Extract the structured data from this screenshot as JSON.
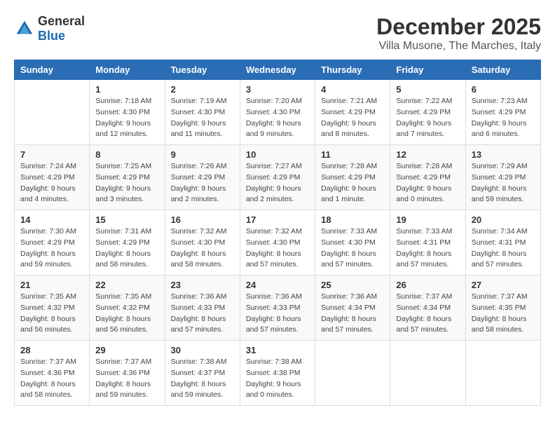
{
  "header": {
    "logo_general": "General",
    "logo_blue": "Blue",
    "month": "December 2025",
    "location": "Villa Musone, The Marches, Italy"
  },
  "days_of_week": [
    "Sunday",
    "Monday",
    "Tuesday",
    "Wednesday",
    "Thursday",
    "Friday",
    "Saturday"
  ],
  "weeks": [
    [
      {
        "day": "",
        "sunrise": "",
        "sunset": "",
        "daylight": ""
      },
      {
        "day": "1",
        "sunrise": "Sunrise: 7:18 AM",
        "sunset": "Sunset: 4:30 PM",
        "daylight": "Daylight: 9 hours and 12 minutes."
      },
      {
        "day": "2",
        "sunrise": "Sunrise: 7:19 AM",
        "sunset": "Sunset: 4:30 PM",
        "daylight": "Daylight: 9 hours and 11 minutes."
      },
      {
        "day": "3",
        "sunrise": "Sunrise: 7:20 AM",
        "sunset": "Sunset: 4:30 PM",
        "daylight": "Daylight: 9 hours and 9 minutes."
      },
      {
        "day": "4",
        "sunrise": "Sunrise: 7:21 AM",
        "sunset": "Sunset: 4:29 PM",
        "daylight": "Daylight: 9 hours and 8 minutes."
      },
      {
        "day": "5",
        "sunrise": "Sunrise: 7:22 AM",
        "sunset": "Sunset: 4:29 PM",
        "daylight": "Daylight: 9 hours and 7 minutes."
      },
      {
        "day": "6",
        "sunrise": "Sunrise: 7:23 AM",
        "sunset": "Sunset: 4:29 PM",
        "daylight": "Daylight: 9 hours and 6 minutes."
      }
    ],
    [
      {
        "day": "7",
        "sunrise": "Sunrise: 7:24 AM",
        "sunset": "Sunset: 4:29 PM",
        "daylight": "Daylight: 9 hours and 4 minutes."
      },
      {
        "day": "8",
        "sunrise": "Sunrise: 7:25 AM",
        "sunset": "Sunset: 4:29 PM",
        "daylight": "Daylight: 9 hours and 3 minutes."
      },
      {
        "day": "9",
        "sunrise": "Sunrise: 7:26 AM",
        "sunset": "Sunset: 4:29 PM",
        "daylight": "Daylight: 9 hours and 2 minutes."
      },
      {
        "day": "10",
        "sunrise": "Sunrise: 7:27 AM",
        "sunset": "Sunset: 4:29 PM",
        "daylight": "Daylight: 9 hours and 2 minutes."
      },
      {
        "day": "11",
        "sunrise": "Sunrise: 7:28 AM",
        "sunset": "Sunset: 4:29 PM",
        "daylight": "Daylight: 9 hours and 1 minute."
      },
      {
        "day": "12",
        "sunrise": "Sunrise: 7:28 AM",
        "sunset": "Sunset: 4:29 PM",
        "daylight": "Daylight: 9 hours and 0 minutes."
      },
      {
        "day": "13",
        "sunrise": "Sunrise: 7:29 AM",
        "sunset": "Sunset: 4:29 PM",
        "daylight": "Daylight: 8 hours and 59 minutes."
      }
    ],
    [
      {
        "day": "14",
        "sunrise": "Sunrise: 7:30 AM",
        "sunset": "Sunset: 4:29 PM",
        "daylight": "Daylight: 8 hours and 59 minutes."
      },
      {
        "day": "15",
        "sunrise": "Sunrise: 7:31 AM",
        "sunset": "Sunset: 4:29 PM",
        "daylight": "Daylight: 8 hours and 58 minutes."
      },
      {
        "day": "16",
        "sunrise": "Sunrise: 7:32 AM",
        "sunset": "Sunset: 4:30 PM",
        "daylight": "Daylight: 8 hours and 58 minutes."
      },
      {
        "day": "17",
        "sunrise": "Sunrise: 7:32 AM",
        "sunset": "Sunset: 4:30 PM",
        "daylight": "Daylight: 8 hours and 57 minutes."
      },
      {
        "day": "18",
        "sunrise": "Sunrise: 7:33 AM",
        "sunset": "Sunset: 4:30 PM",
        "daylight": "Daylight: 8 hours and 57 minutes."
      },
      {
        "day": "19",
        "sunrise": "Sunrise: 7:33 AM",
        "sunset": "Sunset: 4:31 PM",
        "daylight": "Daylight: 8 hours and 57 minutes."
      },
      {
        "day": "20",
        "sunrise": "Sunrise: 7:34 AM",
        "sunset": "Sunset: 4:31 PM",
        "daylight": "Daylight: 8 hours and 57 minutes."
      }
    ],
    [
      {
        "day": "21",
        "sunrise": "Sunrise: 7:35 AM",
        "sunset": "Sunset: 4:32 PM",
        "daylight": "Daylight: 8 hours and 56 minutes."
      },
      {
        "day": "22",
        "sunrise": "Sunrise: 7:35 AM",
        "sunset": "Sunset: 4:32 PM",
        "daylight": "Daylight: 8 hours and 56 minutes."
      },
      {
        "day": "23",
        "sunrise": "Sunrise: 7:36 AM",
        "sunset": "Sunset: 4:33 PM",
        "daylight": "Daylight: 8 hours and 57 minutes."
      },
      {
        "day": "24",
        "sunrise": "Sunrise: 7:36 AM",
        "sunset": "Sunset: 4:33 PM",
        "daylight": "Daylight: 8 hours and 57 minutes."
      },
      {
        "day": "25",
        "sunrise": "Sunrise: 7:36 AM",
        "sunset": "Sunset: 4:34 PM",
        "daylight": "Daylight: 8 hours and 57 minutes."
      },
      {
        "day": "26",
        "sunrise": "Sunrise: 7:37 AM",
        "sunset": "Sunset: 4:34 PM",
        "daylight": "Daylight: 8 hours and 57 minutes."
      },
      {
        "day": "27",
        "sunrise": "Sunrise: 7:37 AM",
        "sunset": "Sunset: 4:35 PM",
        "daylight": "Daylight: 8 hours and 58 minutes."
      }
    ],
    [
      {
        "day": "28",
        "sunrise": "Sunrise: 7:37 AM",
        "sunset": "Sunset: 4:36 PM",
        "daylight": "Daylight: 8 hours and 58 minutes."
      },
      {
        "day": "29",
        "sunrise": "Sunrise: 7:37 AM",
        "sunset": "Sunset: 4:36 PM",
        "daylight": "Daylight: 8 hours and 59 minutes."
      },
      {
        "day": "30",
        "sunrise": "Sunrise: 7:38 AM",
        "sunset": "Sunset: 4:37 PM",
        "daylight": "Daylight: 8 hours and 59 minutes."
      },
      {
        "day": "31",
        "sunrise": "Sunrise: 7:38 AM",
        "sunset": "Sunset: 4:38 PM",
        "daylight": "Daylight: 9 hours and 0 minutes."
      },
      {
        "day": "",
        "sunrise": "",
        "sunset": "",
        "daylight": ""
      },
      {
        "day": "",
        "sunrise": "",
        "sunset": "",
        "daylight": ""
      },
      {
        "day": "",
        "sunrise": "",
        "sunset": "",
        "daylight": ""
      }
    ]
  ]
}
